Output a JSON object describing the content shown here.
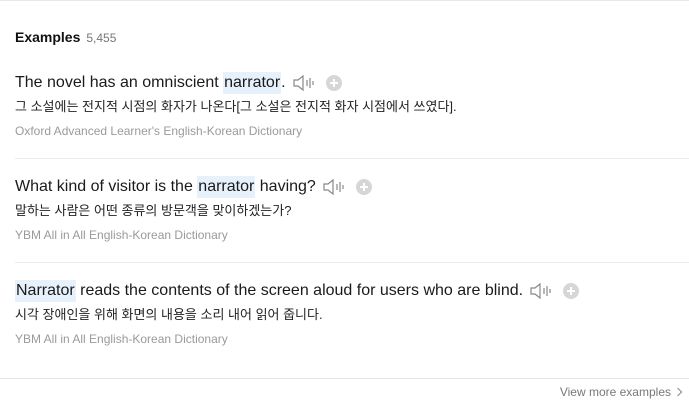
{
  "header": {
    "title": "Examples",
    "count": "5,455"
  },
  "examples": [
    {
      "pre": "The novel has an omniscient ",
      "highlight": "narrator",
      "post": ".",
      "translation": "그 소설에는 전지적 시점의 화자가 나온다[그 소설은 전지적 화자 시점에서 쓰였다].",
      "source": "Oxford Advanced Learner's English-Korean Dictionary"
    },
    {
      "pre": "What kind of visitor is the ",
      "highlight": "narrator",
      "post": " having?",
      "translation": "말하는 사람은 어떤 종류의 방문객을 맞이하겠는가?",
      "source": "YBM All in All English-Korean Dictionary"
    },
    {
      "pre": "",
      "highlight": "Narrator",
      "post": " reads the contents of the screen aloud for users who are blind.",
      "translation": "시각 장애인을 위해 화면의 내용을 소리 내어 읽어 줍니다.",
      "source": "YBM All in All English-Korean Dictionary"
    }
  ],
  "footer": {
    "view_more": "View more examples"
  },
  "icons": {
    "speaker": "speaker-icon",
    "add": "plus-circle-icon",
    "chevron": "chevron-right-icon"
  },
  "colors": {
    "highlight_bg": "#e6f1fb",
    "source_text": "#9a9a9a"
  }
}
